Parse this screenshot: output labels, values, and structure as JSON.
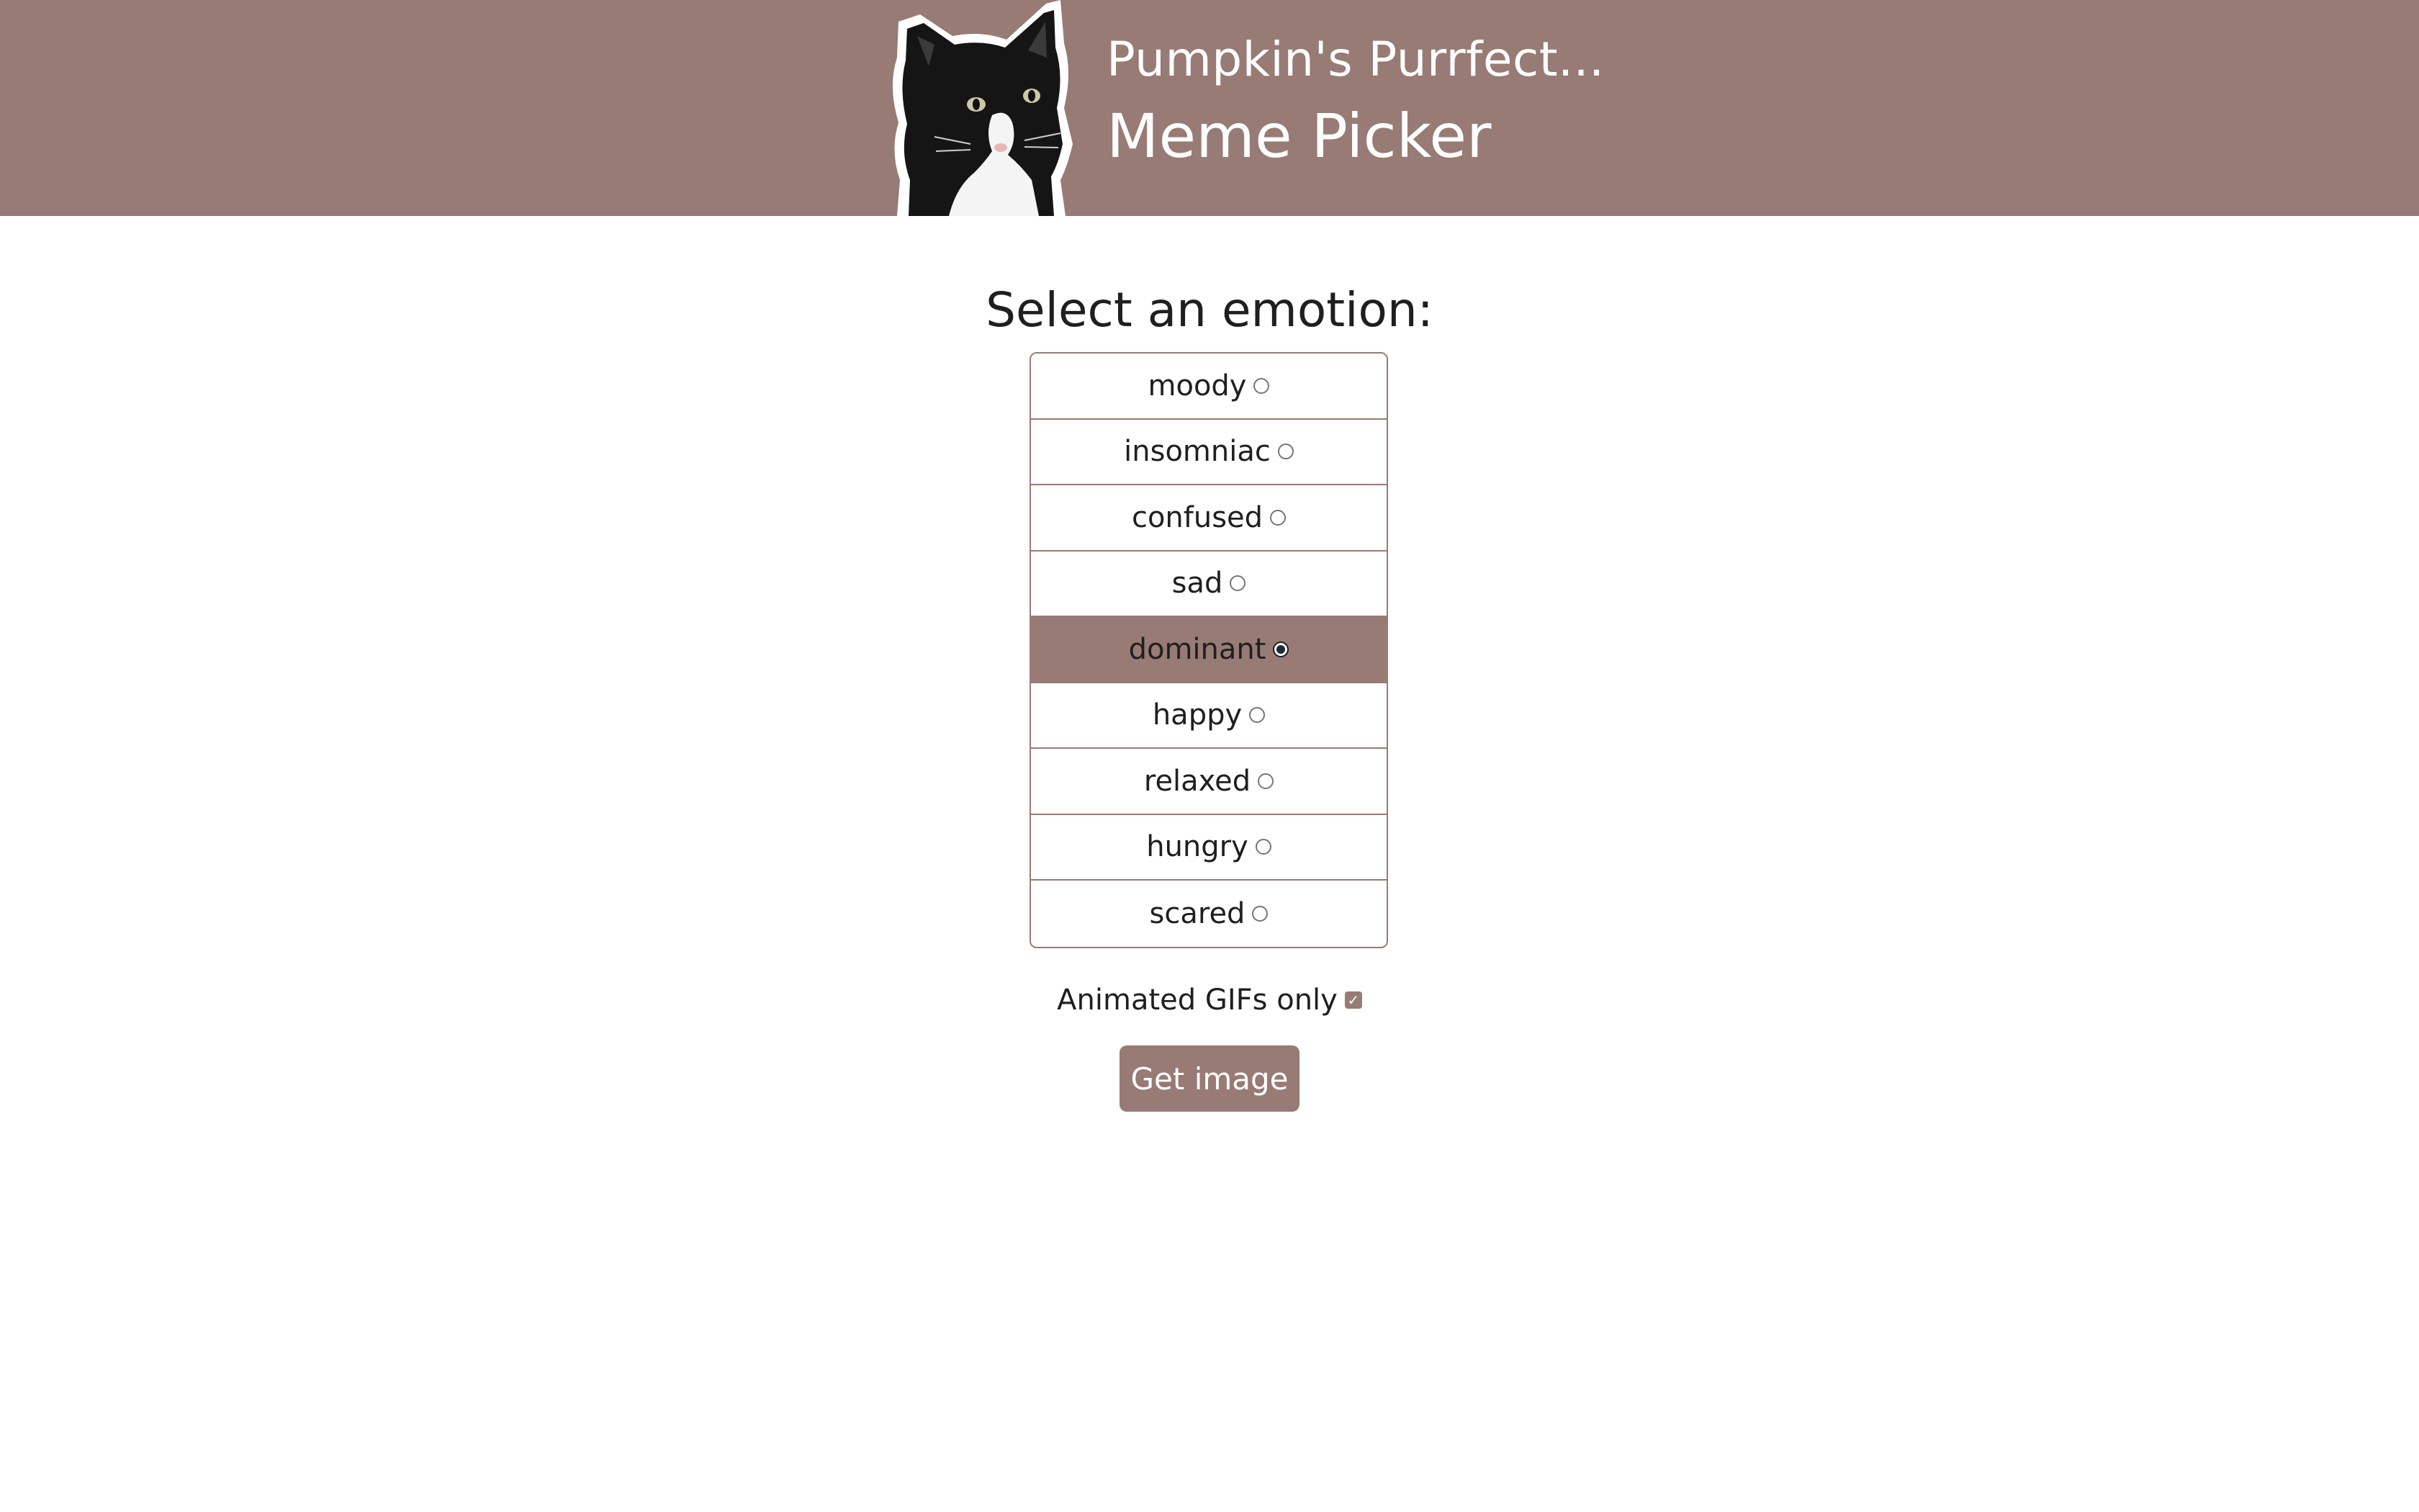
{
  "header": {
    "title_line1": "Pumpkin's Purrfect...",
    "title_line2": "Meme Picker",
    "logo_icon": "cat-logo"
  },
  "main": {
    "heading": "Select an emotion:",
    "emotions": [
      {
        "label": "moody",
        "selected": false
      },
      {
        "label": "insomniac",
        "selected": false
      },
      {
        "label": "confused",
        "selected": false
      },
      {
        "label": "sad",
        "selected": false
      },
      {
        "label": "dominant",
        "selected": true
      },
      {
        "label": "happy",
        "selected": false
      },
      {
        "label": "relaxed",
        "selected": false
      },
      {
        "label": "hungry",
        "selected": false
      },
      {
        "label": "scared",
        "selected": false
      }
    ],
    "gif_only_label": "Animated GIFs only",
    "gif_only_checked": true,
    "button_label": "Get image"
  },
  "colors": {
    "accent": "#977b74",
    "text": "#1f1f1f",
    "background": "#ffffff"
  }
}
